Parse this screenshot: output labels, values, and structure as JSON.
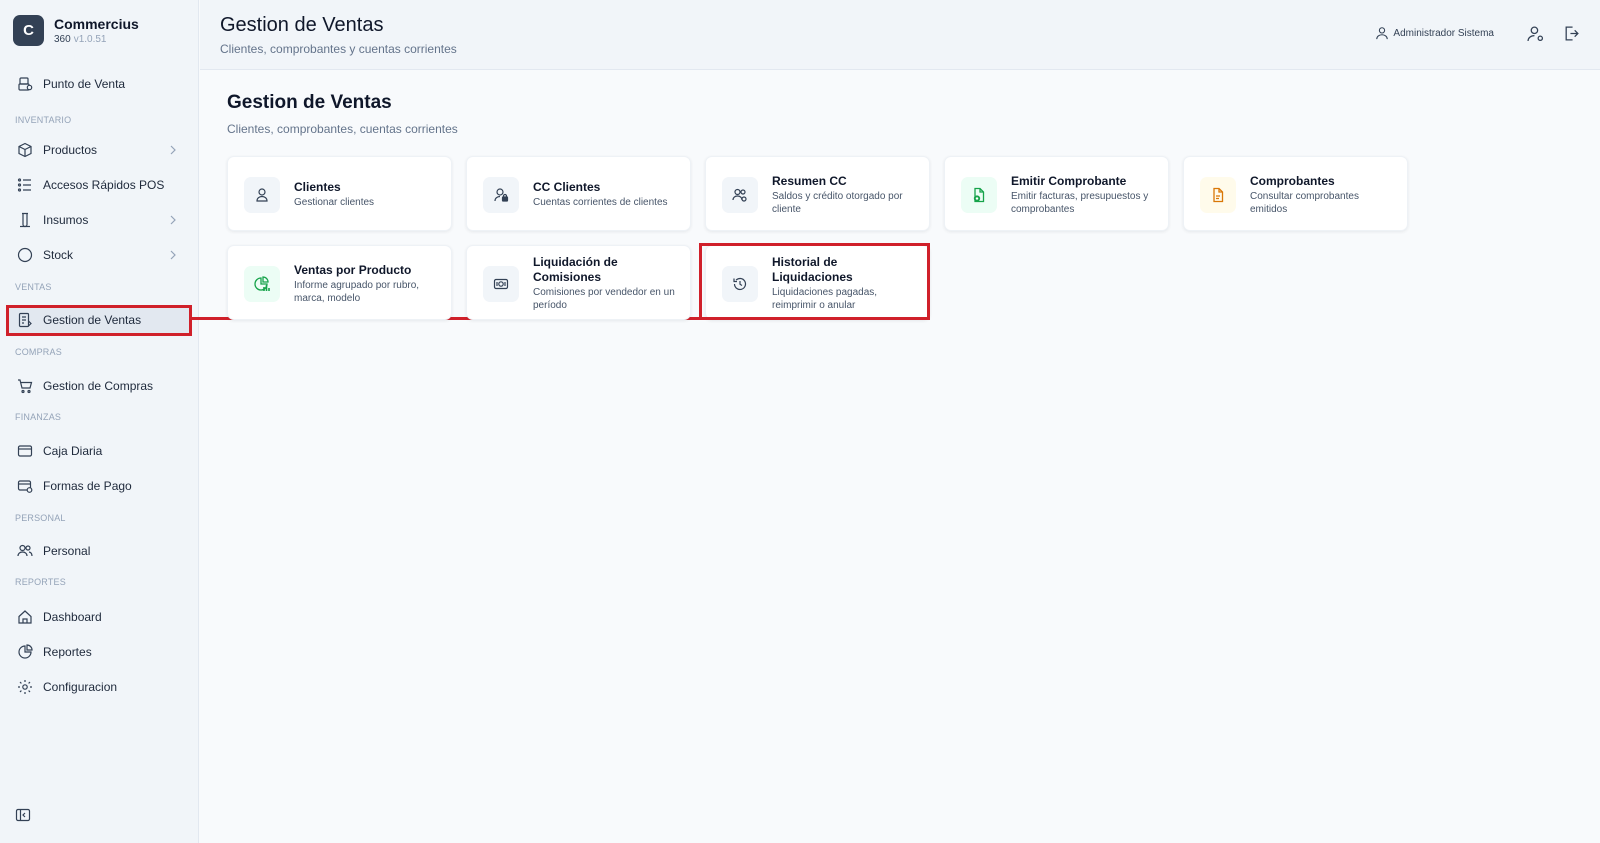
{
  "brand": {
    "logo_letter": "C",
    "name": "Commercius",
    "product": "360",
    "version": "v1.0.51"
  },
  "sidebar": {
    "items": [
      {
        "label": "Punto de Venta",
        "icon": "pos-icon"
      },
      {
        "label": "Productos",
        "icon": "box-icon"
      },
      {
        "label": "Accesos Rápidos POS",
        "icon": "list-icon"
      },
      {
        "label": "Insumos",
        "icon": "flask-icon"
      },
      {
        "label": "Stock",
        "icon": "circle-icon"
      },
      {
        "label": "Gestion de Ventas",
        "icon": "receipt-icon"
      },
      {
        "label": "Gestion de Compras",
        "icon": "cart-icon"
      },
      {
        "label": "Caja Diaria",
        "icon": "wallet-icon"
      },
      {
        "label": "Formas de Pago",
        "icon": "card-icon"
      },
      {
        "label": "Personal",
        "icon": "users-icon"
      },
      {
        "label": "Dashboard",
        "icon": "home-icon"
      },
      {
        "label": "Reportes",
        "icon": "chart-icon"
      },
      {
        "label": "Configuracion",
        "icon": "gear-icon"
      }
    ],
    "sections": [
      "INVENTARIO",
      "VENTAS",
      "COMPRAS",
      "FINANZAS",
      "PERSONAL",
      "REPORTES"
    ]
  },
  "header": {
    "title": "Gestion de Ventas",
    "subtitle": "Clientes, comprobantes y cuentas corrientes",
    "user": "Administrador Sistema"
  },
  "main": {
    "title": "Gestion de Ventas",
    "subtitle": "Clientes, comprobantes, cuentas corrientes",
    "cards": [
      {
        "title": "Clientes",
        "desc": "Gestionar clientes",
        "icon": "user-icon"
      },
      {
        "title": "CC Clientes",
        "desc": "Cuentas corrientes de clientes",
        "icon": "user-lock-icon"
      },
      {
        "title": "Resumen CC",
        "desc": "Saldos y crédito otorgado por cliente",
        "icon": "users-icon"
      },
      {
        "title": "Emitir Comprobante",
        "desc": "Emitir facturas, presupuestos y comprobantes",
        "icon": "file-plus-icon"
      },
      {
        "title": "Comprobantes",
        "desc": "Consultar comprobantes emitidos",
        "icon": "file-icon"
      },
      {
        "title": "Ventas por Producto",
        "desc": "Informe agrupado por rubro, marca, modelo",
        "icon": "chart-pie-icon"
      },
      {
        "title": "Liquidación de Comisiones",
        "desc": "Comisiones por vendedor en un período",
        "icon": "money-icon"
      },
      {
        "title": "Historial de Liquidaciones",
        "desc": "Liquidaciones pagadas, reimprimir o anular",
        "icon": "history-icon"
      }
    ]
  },
  "colors": {
    "highlight": "#d0202a",
    "accent_green": "#16a34a",
    "accent_amber": "#d97706"
  }
}
